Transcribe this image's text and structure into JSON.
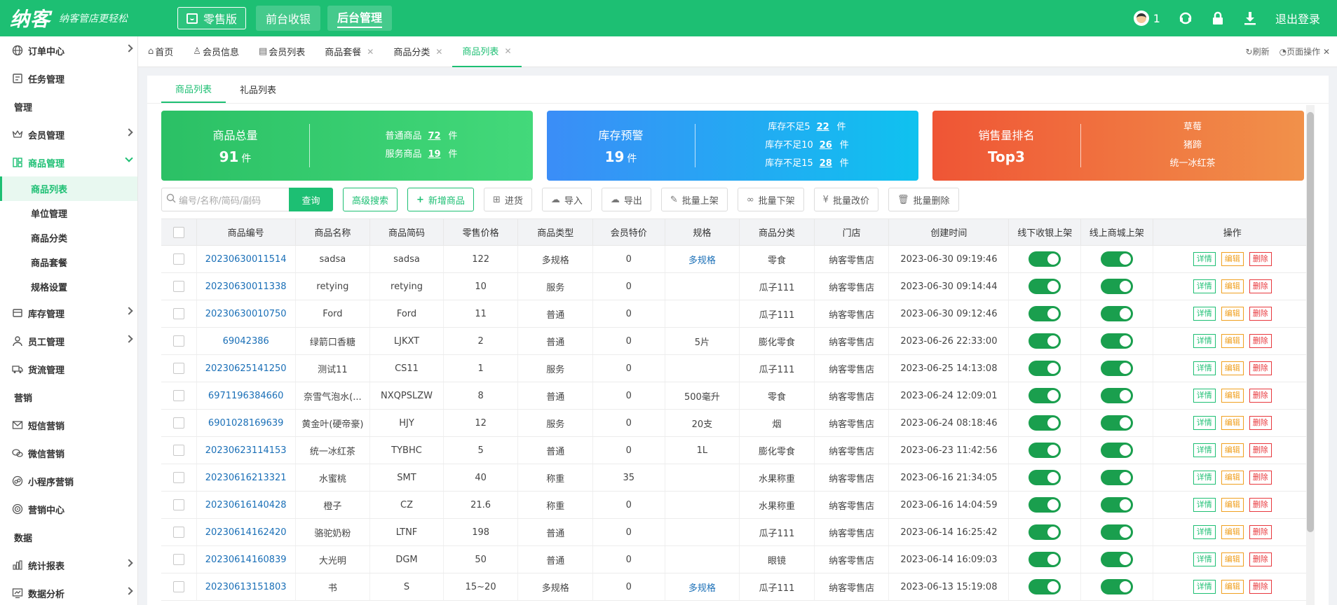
{
  "brand": {
    "logo": "纳客",
    "slogan": "纳客管店更轻松"
  },
  "topbar": {
    "edition": "零售版",
    "nav": [
      "前台收银",
      "后台管理"
    ],
    "user_count": "1",
    "logout": "退出登录"
  },
  "sidebar": {
    "items": [
      {
        "label": "订单中心",
        "icon": "globe-icon",
        "chevron": true
      },
      {
        "label": "任务管理",
        "icon": "task-icon",
        "chevron": false
      }
    ],
    "group_manage": "管理",
    "manage_items": [
      {
        "label": "会员管理",
        "icon": "crown-icon"
      },
      {
        "label": "商品管理",
        "icon": "goods-icon"
      }
    ],
    "sub_items": [
      "商品列表",
      "单位管理",
      "商品分类",
      "商品套餐",
      "规格设置"
    ],
    "after_items": [
      {
        "label": "库存管理",
        "icon": "inventory-icon"
      },
      {
        "label": "员工管理",
        "icon": "user-icon"
      },
      {
        "label": "货流管理",
        "icon": "truck-icon"
      }
    ],
    "group_marketing": "营销",
    "marketing_items": [
      {
        "label": "短信营销",
        "icon": "mail-icon"
      },
      {
        "label": "微信营销",
        "icon": "wechat-icon"
      },
      {
        "label": "小程序营销",
        "icon": "miniapp-icon"
      },
      {
        "label": "营销中心",
        "icon": "target-icon"
      }
    ],
    "group_data": "数据",
    "data_items": [
      {
        "label": "统计报表",
        "icon": "bar-chart-icon"
      },
      {
        "label": "数据分析",
        "icon": "analysis-icon"
      }
    ]
  },
  "tabs": {
    "items": [
      {
        "label": "首页",
        "closable": false
      },
      {
        "label": "会员信息",
        "closable": false
      },
      {
        "label": "会员列表",
        "closable": false
      },
      {
        "label": "商品套餐",
        "closable": true
      },
      {
        "label": "商品分类",
        "closable": true
      },
      {
        "label": "商品列表",
        "closable": true
      }
    ],
    "refresh": "刷新",
    "page_ops": "页面操作"
  },
  "subtabs": [
    "商品列表",
    "礼品列表"
  ],
  "cards": {
    "total": {
      "title": "商品总量",
      "value": "91",
      "unit": "件",
      "rows": [
        {
          "label": "普通商品",
          "value": "72",
          "unit": "件"
        },
        {
          "label": "服务商品",
          "value": "19",
          "unit": "件"
        }
      ]
    },
    "stock": {
      "title": "库存预警",
      "value": "19",
      "unit": "件",
      "rows": [
        {
          "label": "库存不足5",
          "value": "22",
          "unit": "件"
        },
        {
          "label": "库存不足10",
          "value": "26",
          "unit": "件"
        },
        {
          "label": "库存不足15",
          "value": "28",
          "unit": "件"
        }
      ]
    },
    "rank": {
      "title": "销售量排名",
      "value": "Top3",
      "list": [
        "草莓",
        "猪蹄",
        "统一冰红茶"
      ]
    }
  },
  "toolbar": {
    "search_placeholder": "编号/名称/简码/副码",
    "query": "查询",
    "advanced": "高级搜索",
    "add": "新增商品",
    "purchase": "进货",
    "import": "导入",
    "export": "导出",
    "batch_on": "批量上架",
    "batch_off": "批量下架",
    "batch_price": "批量改价",
    "batch_delete": "批量删除"
  },
  "table": {
    "headers": [
      "商品编号",
      "商品名称",
      "商品简码",
      "零售价格",
      "商品类型",
      "会员特价",
      "规格",
      "商品分类",
      "门店",
      "创建时间",
      "线下收银上架",
      "线上商城上架",
      "操作"
    ],
    "ops": {
      "detail": "详情",
      "edit": "编辑",
      "delete": "删除"
    },
    "rows": [
      {
        "code": "20230630011514",
        "name": "sadsa",
        "short": "sadsa",
        "price": "122",
        "type": "多规格",
        "member": "0",
        "spec": "多规格",
        "spec_link": true,
        "category": "零食",
        "store": "纳客零售店",
        "created": "2023-06-30 09:19:46"
      },
      {
        "code": "20230630011338",
        "name": "retying",
        "short": "retying",
        "price": "10",
        "type": "服务",
        "member": "0",
        "spec": "",
        "spec_link": false,
        "category": "瓜子111",
        "store": "纳客零售店",
        "created": "2023-06-30 09:14:44"
      },
      {
        "code": "20230630010750",
        "name": "Ford",
        "short": "Ford",
        "price": "11",
        "type": "普通",
        "member": "0",
        "spec": "",
        "spec_link": false,
        "category": "瓜子111",
        "store": "纳客零售店",
        "created": "2023-06-30 09:12:46"
      },
      {
        "code": "69042386",
        "name": "绿箭口香糖",
        "short": "LJKXT",
        "price": "2",
        "type": "普通",
        "member": "0",
        "spec": "5片",
        "spec_link": false,
        "category": "膨化零食",
        "store": "纳客零售店",
        "created": "2023-06-26 22:33:00"
      },
      {
        "code": "20230625141250",
        "name": "测试11",
        "short": "CS11",
        "price": "1",
        "type": "服务",
        "member": "0",
        "spec": "",
        "spec_link": false,
        "category": "瓜子111",
        "store": "纳客零售店",
        "created": "2023-06-25 14:13:08"
      },
      {
        "code": "6971196384660",
        "name": "奈雪气泡水(...",
        "short": "NXQPSLZW",
        "price": "8",
        "type": "普通",
        "member": "0",
        "spec": "500毫升",
        "spec_link": false,
        "category": "零食",
        "store": "纳客零售店",
        "created": "2023-06-24 12:09:01"
      },
      {
        "code": "6901028169639",
        "name": "黄金叶(硬帝豪)",
        "short": "HJY",
        "price": "12",
        "type": "服务",
        "member": "0",
        "spec": "20支",
        "spec_link": false,
        "category": "烟",
        "store": "纳客零售店",
        "created": "2023-06-24 08:18:46"
      },
      {
        "code": "20230623114153",
        "name": "统一冰红茶",
        "short": "TYBHC",
        "price": "5",
        "type": "普通",
        "member": "0",
        "spec": "1L",
        "spec_link": false,
        "category": "膨化零食",
        "store": "纳客零售店",
        "created": "2023-06-23 11:42:56"
      },
      {
        "code": "20230616213321",
        "name": "水蜜桃",
        "short": "SMT",
        "price": "40",
        "type": "称重",
        "member": "35",
        "spec": "",
        "spec_link": false,
        "category": "水果称重",
        "store": "纳客零售店",
        "created": "2023-06-16 21:34:05"
      },
      {
        "code": "20230616140428",
        "name": "橙子",
        "short": "CZ",
        "price": "21.6",
        "type": "称重",
        "member": "0",
        "spec": "",
        "spec_link": false,
        "category": "水果称重",
        "store": "纳客零售店",
        "created": "2023-06-16 14:04:59"
      },
      {
        "code": "20230614162420",
        "name": "骆驼奶粉",
        "short": "LTNF",
        "price": "198",
        "type": "普通",
        "member": "0",
        "spec": "",
        "spec_link": false,
        "category": "瓜子111",
        "store": "纳客零售店",
        "created": "2023-06-14 16:25:42"
      },
      {
        "code": "20230614160839",
        "name": "大光明",
        "short": "DGM",
        "price": "50",
        "type": "普通",
        "member": "0",
        "spec": "",
        "spec_link": false,
        "category": "眼镜",
        "store": "纳客零售店",
        "created": "2023-06-14 16:09:03"
      },
      {
        "code": "20230613151803",
        "name": "书",
        "short": "S",
        "price": "15~20",
        "type": "多规格",
        "member": "0",
        "spec": "多规格",
        "spec_link": true,
        "category": "瓜子111",
        "store": "纳客零售店",
        "created": "2023-06-13 15:19:08"
      }
    ]
  },
  "colors": {
    "brand_green": "#1dbf73",
    "link_blue": "#1a6fb7",
    "edit_orange": "#f0a020",
    "delete_red": "#e8383d"
  }
}
